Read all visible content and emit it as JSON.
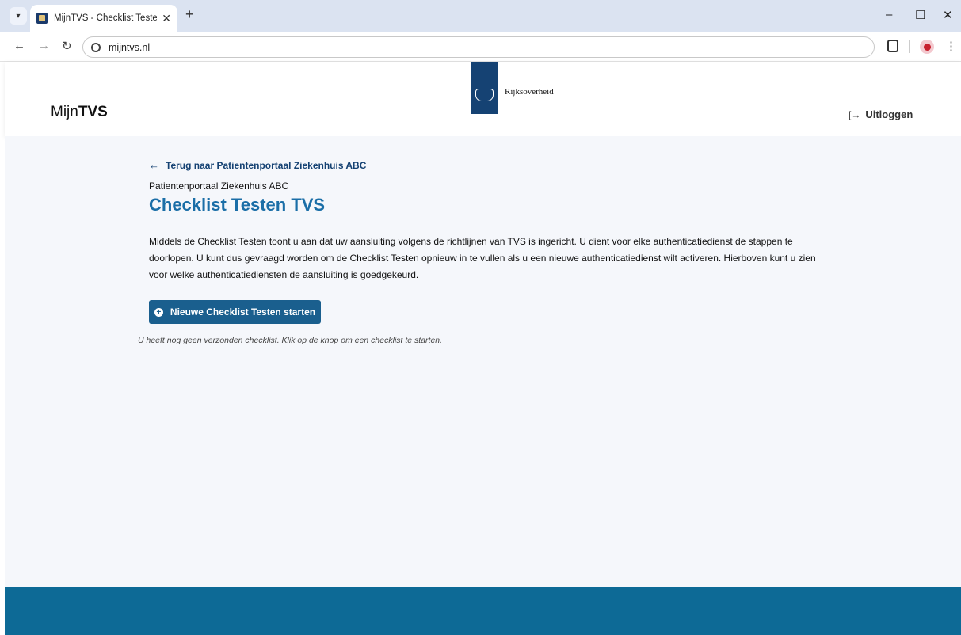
{
  "browser": {
    "tab_title": "MijnTVS - Checklist Testen - Ov",
    "tab_close": "✕",
    "new_tab": "+",
    "url": "mijntvs.nl",
    "minimize": "–",
    "maximize": "☐",
    "close": "✕"
  },
  "header": {
    "brand_prefix": "Mijn",
    "brand_bold": "TVS",
    "logo_text": "Rijksoverheid",
    "logout_label": "Uitloggen"
  },
  "main": {
    "back_link": "Terug naar Patientenportaal Ziekenhuis ABC",
    "subtitle": "Patientenportaal Ziekenhuis ABC",
    "title": "Checklist Testen TVS",
    "intro": "Middels de Checklist Testen toont u aan dat uw aansluiting volgens de richtlijnen van TVS is ingericht. U dient voor elke authenticatiedienst de stappen te doorlopen. U kunt dus gevraagd worden om de Checklist Testen opnieuw in te vullen als u een nieuwe authenticatiedienst wilt activeren. Hierboven kunt u zien voor welke authenticatiediensten de aansluiting is goedgekeurd.",
    "start_button": "Nieuwe Checklist Testen starten",
    "empty_note": "U heeft nog geen verzonden checklist. Klik op de knop om een checklist te starten."
  },
  "colors": {
    "primary": "#154273",
    "title": "#1a6ea7",
    "button": "#1a5f8e",
    "footer": "#0d6a96",
    "background": "#f5f7fb"
  }
}
